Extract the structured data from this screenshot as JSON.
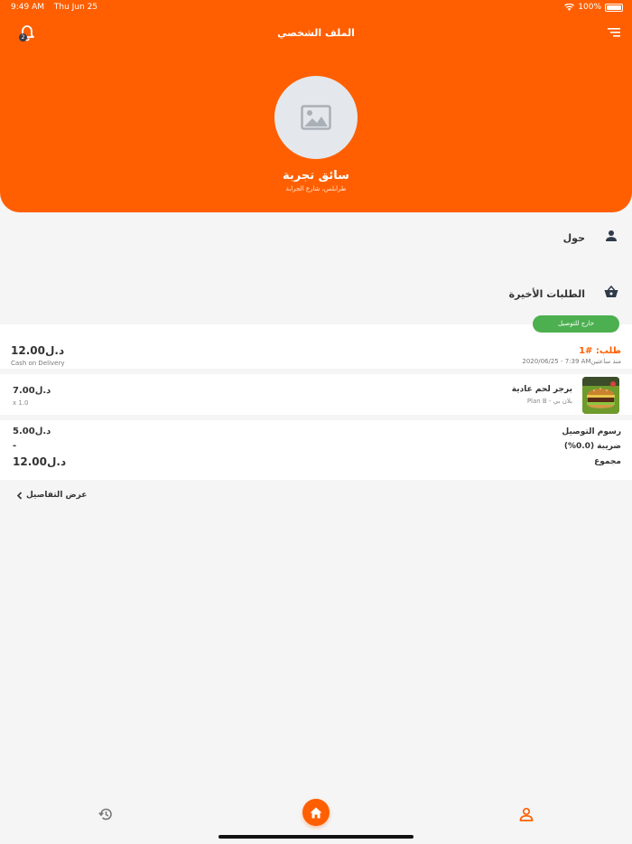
{
  "status_bar": {
    "time": "9:49 AM",
    "date": "Thu Jun 25",
    "battery": "100%"
  },
  "header": {
    "title": "الملف الشخصي",
    "notification_count": "2",
    "driver_name": "سائق تجربة",
    "driver_address": "طرابلس، شارع الجرابة"
  },
  "sections": {
    "about": "حول",
    "recent_orders": "الطلبات الأخيرة"
  },
  "order": {
    "status": "خارج للتوصيل",
    "title": "طلب: #1",
    "date": "2020/06/25 - 7:39 AMمنذ ساعتين",
    "total": "12.00د.ل",
    "payment_method": "Cash on Delivery",
    "item": {
      "name": "برجر لحم عادية",
      "restaurant": "Plan B - بلان بي",
      "price": "7.00د.ل",
      "quantity": "x 1.0"
    },
    "summary": {
      "delivery_fee_label": "رسوم التوصيل",
      "delivery_fee_value": "5.00د.ل",
      "tax_label": "ضريبة (0.0%)",
      "tax_value": "-",
      "total_label": "مجموع",
      "total_value": "12.00د.ل"
    },
    "details_link": "عرض التفاصيل"
  },
  "colors": {
    "brand": "#ff5f00",
    "status_green": "#4caf50",
    "icon_dark": "#2f3a4a"
  },
  "bottom_nav": {
    "active": "profile",
    "items": [
      "history-icon",
      "home-icon",
      "profile-icon"
    ]
  }
}
